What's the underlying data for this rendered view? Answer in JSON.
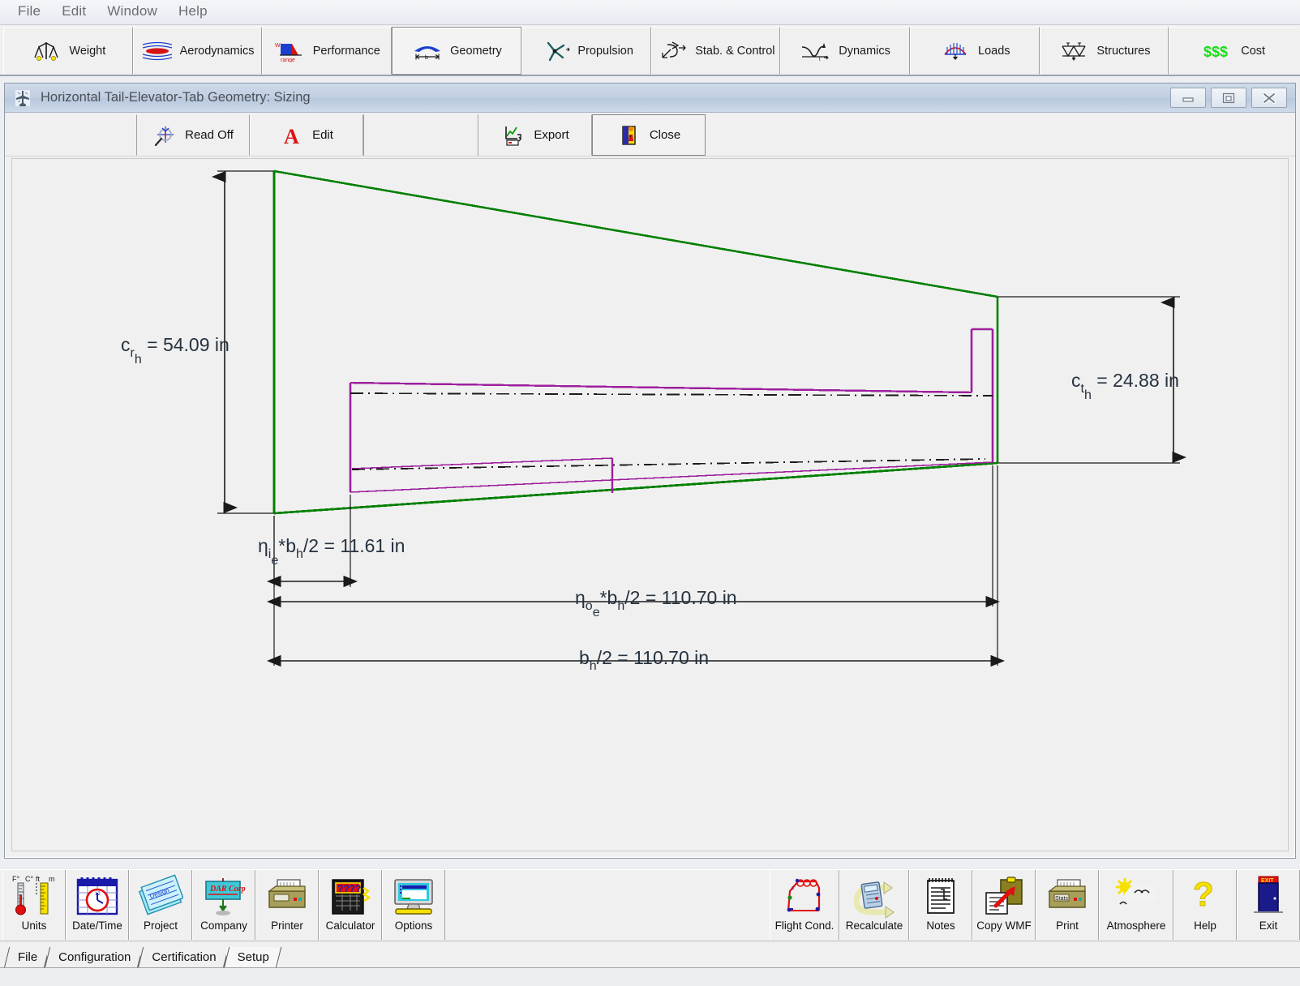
{
  "menubar": {
    "items": [
      {
        "label": "File"
      },
      {
        "label": "Edit"
      },
      {
        "label": "Window"
      },
      {
        "label": "Help"
      }
    ]
  },
  "ribbon": {
    "tabs": [
      {
        "label": "Weight",
        "icon": "balance-scale-icon",
        "active": false
      },
      {
        "label": "Aerodynamics",
        "icon": "airfoil-flow-icon",
        "active": false
      },
      {
        "label": "Performance",
        "icon": "range-chart-icon",
        "active": false
      },
      {
        "label": "Geometry",
        "icon": "wing-span-icon",
        "active": true
      },
      {
        "label": "Propulsion",
        "icon": "propeller-icon",
        "active": false
      },
      {
        "label": "Stab. & Control",
        "icon": "axes-arrows-icon",
        "active": false
      },
      {
        "label": "Dynamics",
        "icon": "response-curve-icon",
        "active": false
      },
      {
        "label": "Loads",
        "icon": "load-arch-icon",
        "active": false
      },
      {
        "label": "Structures",
        "icon": "truss-icon",
        "active": false
      },
      {
        "label": "Cost",
        "icon": "dollars-icon",
        "active": false
      }
    ]
  },
  "child_window": {
    "title": "Horizontal Tail-Elevator-Tab Geometry: Sizing",
    "title_icon": "app-aircraft-icon",
    "controls": [
      {
        "name": "minimize",
        "glyph": "minimize-icon"
      },
      {
        "name": "maximize",
        "glyph": "maximize-icon"
      },
      {
        "name": "close",
        "glyph": "close-icon"
      }
    ],
    "toolbar": [
      {
        "label": "Read Off",
        "icon": "crosshair-magnifier-icon",
        "pressed": false
      },
      {
        "label": "Edit",
        "icon": "letter-a-icon",
        "pressed": false
      },
      {
        "label": "Export",
        "icon": "export-chart-icon",
        "pressed": false
      },
      {
        "label": "Close",
        "icon": "exit-door-icon",
        "pressed": true
      }
    ]
  },
  "chart_data": {
    "type": "diagram",
    "title": "Horizontal Tail-Elevator-Tab Planform (half-span)",
    "units": "in",
    "colors": {
      "tail_outline": "#008000",
      "elevator_tab": "#9e1f9e",
      "dimension": "#1a1a1a",
      "label_text": "#26323f",
      "background": "#f0f0f0"
    },
    "annotations": [
      {
        "name": "root-chord",
        "text": "c",
        "sub": "r",
        "subsub": "h",
        "value": "54.09",
        "unit": "in",
        "full": "c_rh = 54.09 in"
      },
      {
        "name": "tip-chord",
        "text": "c",
        "sub": "t",
        "subsub": "h",
        "value": "24.88",
        "unit": "in",
        "full": "c_th = 24.88 in"
      },
      {
        "name": "elevator-inboard",
        "text": "η",
        "sub": "i",
        "subsub": "e",
        "expr": "*b",
        "exprsub": "h",
        "exprtail": "/2",
        "value": "11.61",
        "unit": "in",
        "full": "ηie*bh/2 = 11.61 in"
      },
      {
        "name": "elevator-outboard",
        "text": "η",
        "sub": "o",
        "subsub": "e",
        "expr": "*b",
        "exprsub": "h",
        "exprtail": "/2",
        "value": "110.70",
        "unit": "in",
        "full": "ηoe*bh/2 = 110.70 in"
      },
      {
        "name": "half-span",
        "text": "b",
        "sub": "h",
        "subsub": "",
        "exprtail": "/2",
        "value": "110.70",
        "unit": "in",
        "full": "bh/2 = 110.70 in"
      }
    ],
    "values": {
      "root_chord_in": 54.09,
      "tip_chord_in": 24.88,
      "eta_i_e_times_half_span_in": 11.61,
      "eta_o_e_times_half_span_in": 110.7,
      "half_span_in": 110.7
    },
    "labels": {
      "root_chord_symbol": "c",
      "root_chord_sub": "r",
      "root_chord_subsub": "h",
      "root_chord_eq": "= 54.09 in",
      "tip_chord_symbol": "c",
      "tip_chord_sub": "t",
      "tip_chord_subsub": "h",
      "tip_chord_eq": "= 24.88 in",
      "eta_i_symbol": "η",
      "eta_i_sub": "i",
      "eta_i_subsub": "e",
      "eta_i_mid": "*b",
      "eta_i_midsub": "h",
      "eta_i_eq": "/2 = 11.61 in",
      "eta_o_symbol": "η",
      "eta_o_sub": "o",
      "eta_o_subsub": "e",
      "eta_o_mid": "*b",
      "eta_o_midsub": "h",
      "eta_o_eq": "/2 = 110.70 in",
      "span_symbol": "b",
      "span_sub": "h",
      "span_eq": "/2 = 110.70 in"
    }
  },
  "bottom_toolbar": {
    "left": [
      {
        "label": "Units",
        "icon": "thermometer-ruler-icon"
      },
      {
        "label": "Date/Time",
        "icon": "calendar-clock-icon"
      },
      {
        "label": "Project",
        "icon": "blueprints-icon"
      },
      {
        "label": "Company",
        "icon": "company-sign-icon"
      },
      {
        "label": "Printer",
        "icon": "printer-icon"
      },
      {
        "label": "Calculator",
        "icon": "calculator-icon"
      },
      {
        "label": "Options",
        "icon": "monitor-options-icon"
      }
    ],
    "right": [
      {
        "label": "Flight Cond.",
        "icon": "flight-envelope-icon"
      },
      {
        "label": "Recalculate",
        "icon": "recalculate-icon"
      },
      {
        "label": "Notes",
        "icon": "notepad-icon"
      },
      {
        "label": "Copy WMF",
        "icon": "copy-clipboard-icon"
      },
      {
        "label": "Print",
        "icon": "print-icon"
      },
      {
        "label": "Atmosphere",
        "icon": "sun-cloud-icon"
      },
      {
        "label": "Help",
        "icon": "question-mark-icon"
      },
      {
        "label": "Exit",
        "icon": "exit-sign-door-icon"
      }
    ]
  },
  "tabstrip": {
    "tabs": [
      {
        "label": "File",
        "selected": false
      },
      {
        "label": "Configuration",
        "selected": false
      },
      {
        "label": "Certification",
        "selected": false
      },
      {
        "label": "Setup",
        "selected": true
      }
    ]
  }
}
